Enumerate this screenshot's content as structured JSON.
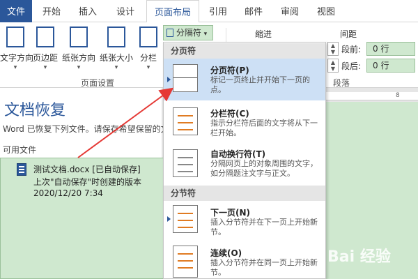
{
  "tabs": [
    {
      "label": "文件"
    },
    {
      "label": "开始"
    },
    {
      "label": "插入"
    },
    {
      "label": "设计"
    },
    {
      "label": "页面布局"
    },
    {
      "label": "引用"
    },
    {
      "label": "邮件"
    },
    {
      "label": "审阅"
    },
    {
      "label": "视图"
    }
  ],
  "ribbon": {
    "buttons": [
      {
        "label": "文字方向"
      },
      {
        "label": "页边距"
      },
      {
        "label": "纸张方向"
      },
      {
        "label": "纸张大小"
      },
      {
        "label": "分栏"
      }
    ],
    "dropdown_arrow": "▾",
    "group_page_setup": "页面设置",
    "breaks_button": "分隔符",
    "breaks_arrow": "▾",
    "indent_label": "缩进",
    "spacing_label": "间距",
    "before_label": "段前:",
    "after_label": "段后:",
    "before_value": "0 行",
    "after_value": "0 行",
    "group_paragraph": "段落"
  },
  "recovery": {
    "title": "文档恢复",
    "description": "Word 已恢复下列文件。请保存希望保留的文",
    "available_label": "可用文件",
    "file": {
      "name": "测试文档.docx  [已自动保存]",
      "subtitle": "上次\"自动保存\"时创建的版本",
      "timestamp": "2020/12/20 7:34"
    }
  },
  "ruler_number": "8",
  "breaks_menu": {
    "sections": [
      {
        "header": "分页符",
        "items": [
          {
            "title": "分页符(P)",
            "desc": "标记一页终止并开始下一页的点。",
            "highlighted": true
          },
          {
            "title": "分栏符(C)",
            "desc": "指示分栏符后面的文字将从下一栏开始。"
          },
          {
            "title": "自动换行符(T)",
            "desc": "分隔网页上的对象周围的文字，如分隔题注文字与正文。"
          }
        ]
      },
      {
        "header": "分节符",
        "items": [
          {
            "title": "下一页(N)",
            "desc": "插入分节符并在下一页上开始新节。"
          },
          {
            "title": "连续(O)",
            "desc": "插入分节符并在同一页上开始新节。"
          }
        ]
      }
    ]
  },
  "watermark": "Bai 经验",
  "colors": {
    "accent": "#2b579a",
    "highlight": "#cde0f5",
    "green_fill": "#cfe8cf",
    "arrow": "#e53935"
  }
}
